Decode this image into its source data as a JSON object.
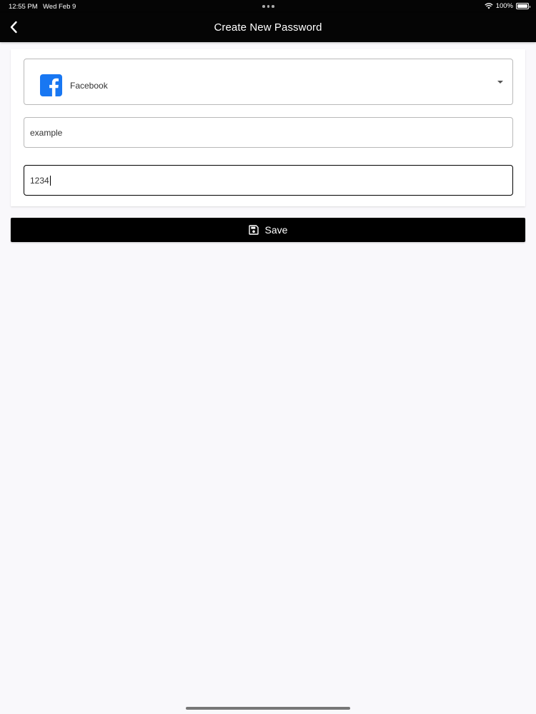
{
  "status_bar": {
    "time": "12:55 PM",
    "date": "Wed Feb 9",
    "battery": "100%",
    "battery_level": 1.0
  },
  "nav": {
    "title": "Create New Password",
    "back_icon": "chevron-left-icon"
  },
  "form": {
    "service": {
      "selected": "Facebook",
      "icon": "facebook-icon",
      "icon_color": "#1877f2"
    },
    "username": {
      "value": "example"
    },
    "password": {
      "value": "1234"
    }
  },
  "actions": {
    "save_label": "Save",
    "save_icon": "floppy-disk-icon",
    "button_color": "#000000"
  }
}
